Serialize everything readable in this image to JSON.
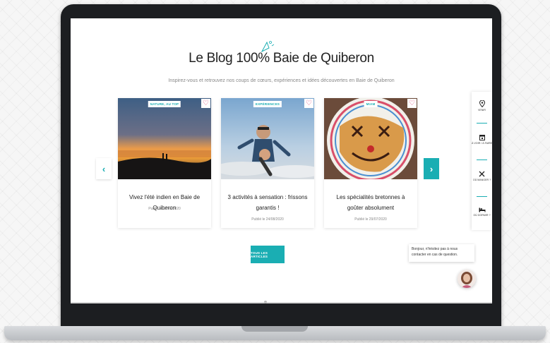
{
  "blog": {
    "title": "Le Blog 100% Baie de Quiberon",
    "subtitle": "Inspirez-vous et retrouvez nos coups de cœurs, expériences et idées découvertes en Baie de Quiberon"
  },
  "cards": [
    {
      "tag": "NATURE, AU TOP",
      "title": "Vivez l'été indien en Baie de Quiberon",
      "date": "Publié le 22/09/2020"
    },
    {
      "tag": "EXPÉRIENCES",
      "title": "3 activités à sensation : frissons garantis !",
      "date": "Publié le 24/08/2020"
    },
    {
      "tag": "MIAM",
      "title": "Les spécialités bretonnes à goûter absolument",
      "date": "Publié le 29/07/2020"
    }
  ],
  "carousel": {
    "prev_label": "‹",
    "next_label": "›"
  },
  "all_articles_label": "TOUS LES ARTICLES",
  "side_toolbar": [
    {
      "icon": "map-pin-icon",
      "label": "VENIR"
    },
    {
      "icon": "calendar-icon",
      "label": "À VOIR / À FAIRE"
    },
    {
      "icon": "fork-knife-icon",
      "label": "OÙ MANGER ?"
    },
    {
      "icon": "bed-icon",
      "label": "OÙ DORMIR ?"
    }
  ],
  "chat": {
    "message": "Bonjour, n'hésitez pas à nous contacter en cas de question."
  },
  "colors": {
    "accent": "#1aaeb3",
    "heart": "#e0457b",
    "laptop": "#1c1e21"
  }
}
